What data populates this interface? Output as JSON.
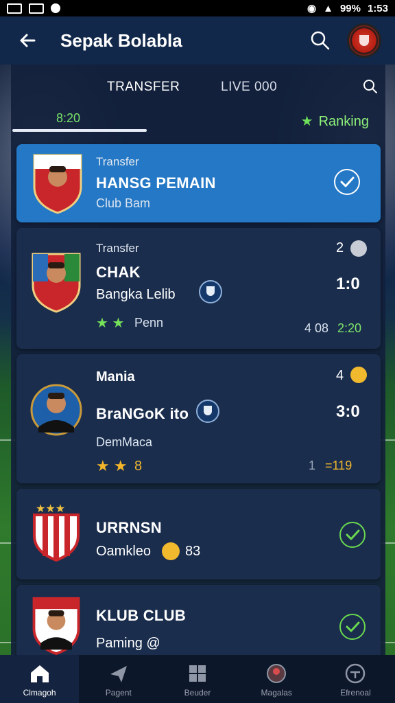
{
  "status_bar": {
    "battery": "99%",
    "time": "1:53"
  },
  "app_bar": {
    "title": "Sepak Bolabla",
    "back_icon": "arrow-left-icon",
    "search_icon": "search-icon"
  },
  "tabs": {
    "transfer": "TRANSFER",
    "live": "LIVE 000"
  },
  "subtabs": {
    "left": "8:20",
    "ranking": "Ranking"
  },
  "colors": {
    "accent": "#2478c5",
    "green": "#6ad84f",
    "gold": "#f3b52a",
    "panel": "#1a2d4d"
  },
  "cards": [
    {
      "kind": "Transfer",
      "title": "HANSG PEMAIN",
      "subtitle": "Club Bam"
    },
    {
      "kind": "Transfer",
      "title": "CHAK",
      "club": "Bangka Lelib",
      "rating": "Penn",
      "num": "2",
      "score": "1:0",
      "time_left": "4 08",
      "time_right": "2:20"
    },
    {
      "kind": "Mania",
      "club": "BraNGoK ito",
      "player": "DemMaca",
      "rating": "8",
      "num": "4",
      "score": "3:0",
      "min_left": "1",
      "min_right": "=119"
    },
    {
      "title": "URRNSN",
      "subtitle": "Oamkleo",
      "count": "83"
    },
    {
      "title": "KLUB CLUB",
      "subtitle": "Paming @"
    }
  ],
  "nav": [
    {
      "label": "Clmagoh",
      "icon": "home-icon"
    },
    {
      "label": "Pagent",
      "icon": "send-icon"
    },
    {
      "label": "Beuder",
      "icon": "grid-icon"
    },
    {
      "label": "Magalas",
      "icon": "ball-icon"
    },
    {
      "label": "Efrenoal",
      "icon": "profile-icon"
    }
  ]
}
